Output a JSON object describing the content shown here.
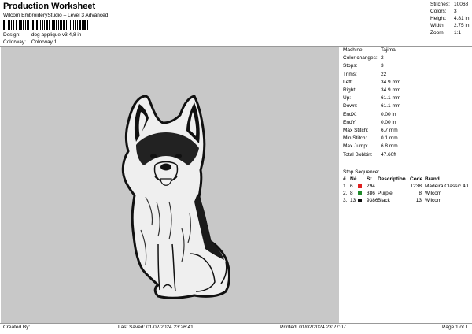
{
  "header": {
    "title": "Production Worksheet",
    "software": "Wilcom EmbroideryStudio – Level 3 Advanced",
    "design_label": "Design:",
    "design_value": "dog applique v3 4,8 in",
    "colorway_label": "Colorway:",
    "colorway_value": "Colorway 1"
  },
  "stats": {
    "stitches_label": "Stitches:",
    "stitches_value": "10068",
    "colors_label": "Colors:",
    "colors_value": "3",
    "height_label": "Height:",
    "height_value": "4.81 in",
    "width_label": "Width:",
    "width_value": "2.75 in",
    "zoom_label": "Zoom:",
    "zoom_value": "1:1"
  },
  "machine_info": [
    {
      "label": "Machine:",
      "value": "Tajima"
    },
    {
      "label": "Color changes:",
      "value": "2"
    },
    {
      "label": "Stops:",
      "value": "3"
    },
    {
      "label": "Trims:",
      "value": "22"
    },
    {
      "label": "Left:",
      "value": "34.9 mm"
    },
    {
      "label": "Right:",
      "value": "34.9 mm"
    },
    {
      "label": "Up:",
      "value": "61.1 mm"
    },
    {
      "label": "Down:",
      "value": "61.1 mm"
    },
    {
      "label": "EndX:",
      "value": "0.00 in"
    },
    {
      "label": "EndY:",
      "value": "0.00 in"
    },
    {
      "label": "Max Stitch:",
      "value": "6.7 mm"
    },
    {
      "label": "Min Stitch:",
      "value": "0.1 mm"
    },
    {
      "label": "Max Jump:",
      "value": "6.8 mm"
    },
    {
      "label": "Total Bobbin:",
      "value": "47.60ft"
    }
  ],
  "stop_sequence": {
    "title": "Stop Sequence:",
    "headers": {
      "num": "#",
      "n": "N#",
      "st": "St.",
      "description": "Description",
      "code": "Code",
      "brand": "Brand"
    },
    "rows": [
      {
        "num": "1.",
        "n": "6",
        "color": "#e02020",
        "st": "294",
        "description": "",
        "code": "1238",
        "brand": "Madeira Classic 40"
      },
      {
        "num": "2.",
        "n": "8",
        "color": "#1f8a2a",
        "st": "386",
        "description": "Purple",
        "code": "8",
        "brand": "Wilcom"
      },
      {
        "num": "3.",
        "n": "13",
        "color": "#111111",
        "st": "9386",
        "description": "Black",
        "code": "13",
        "brand": "Wilcom"
      }
    ]
  },
  "footer": {
    "created_by": "Created By:",
    "last_saved": "Last Saved: 01/02/2024 23:26:41",
    "printed": "Printed: 01/02/2024 23:27:07",
    "page": "Page 1 of 1"
  },
  "colors": {
    "preview_bg": "#c8c8c8",
    "applique_fill": "#f0f0f0",
    "outline": "#111111"
  }
}
